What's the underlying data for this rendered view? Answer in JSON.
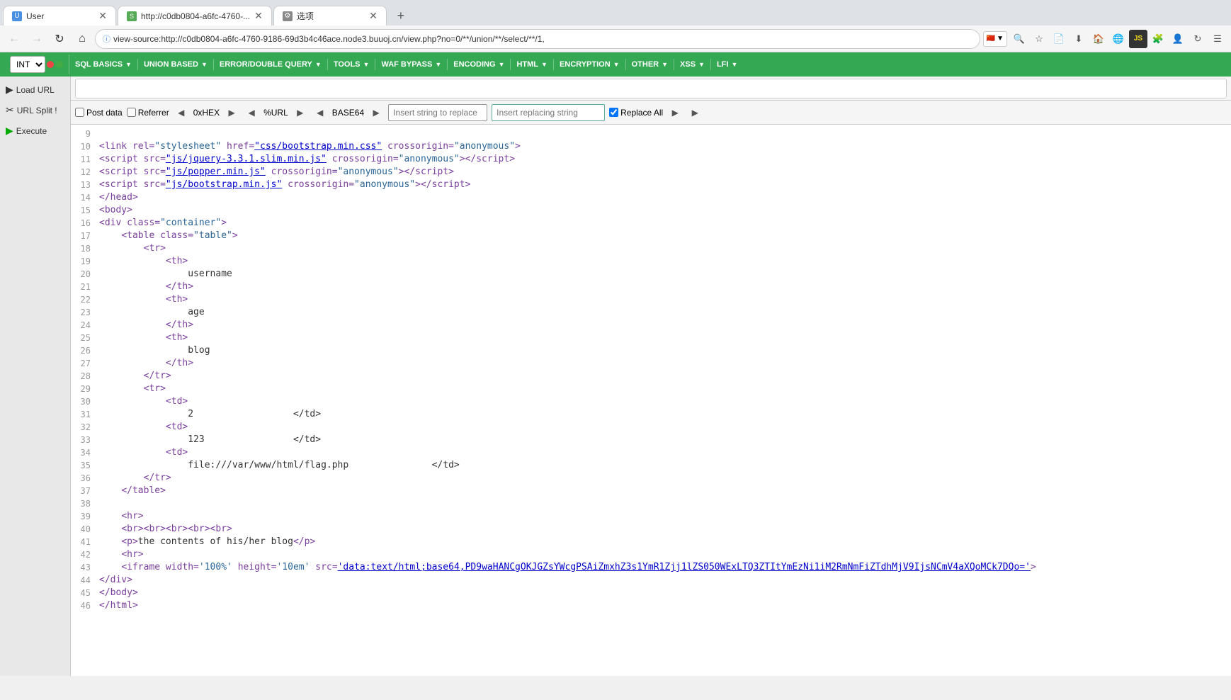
{
  "tabs": [
    {
      "id": "tab1",
      "title": "User",
      "favicon": "U",
      "active": false,
      "closeable": true
    },
    {
      "id": "tab2",
      "title": "http://c0db0804-a6fc-4760-...",
      "favicon": "S",
      "active": true,
      "closeable": true
    },
    {
      "id": "tab3",
      "title": "选项",
      "favicon": "⚙",
      "active": false,
      "closeable": true
    }
  ],
  "address": "view-source:http://c0db0804-a6fc-4760-9186-69d3b4c46ace.node3.buuoj.cn/view.php?no=0/**/union/**/select/**/1,",
  "ext_bar": {
    "items": [
      {
        "label": "INT",
        "dropdown": true
      },
      {
        "label": "SQL BASICS",
        "dropdown": true
      },
      {
        "label": "UNION BASED",
        "dropdown": true
      },
      {
        "label": "ERROR/DOUBLE QUERY",
        "dropdown": true
      },
      {
        "label": "TOOLS",
        "dropdown": true
      },
      {
        "label": "WAF BYPASS",
        "dropdown": true
      },
      {
        "label": "ENCODING",
        "dropdown": true
      },
      {
        "label": "HTML",
        "dropdown": true
      },
      {
        "label": "ENCRYPTION",
        "dropdown": true
      },
      {
        "label": "OTHER",
        "dropdown": true
      },
      {
        "label": "XSS",
        "dropdown": true
      },
      {
        "label": "LFI",
        "dropdown": true
      }
    ]
  },
  "sidebar": {
    "load_url": "Load URL",
    "split_url": "Split !",
    "split_label": "URL Split !",
    "execute": "Execute"
  },
  "toolbar": {
    "post_data_label": "Post data",
    "referrer_label": "Referrer",
    "hex_label": "0xHEX",
    "url_label": "%URL",
    "base64_label": "BASE64",
    "insert_from_placeholder": "Insert string to replace",
    "insert_to_placeholder": "Insert replacing string",
    "replace_all_label": "Replace All"
  },
  "source_lines": [
    {
      "num": "9",
      "parts": []
    },
    {
      "num": "10",
      "html": "<span class='line-content'><span class='tag'>&lt;link rel=</span><span class='attr-value'>\"stylesheet\"</span> <span class='tag'>href=</span><span class='link-text'>\"css/bootstrap.min.css\"</span> <span class='tag'>crossorigin=</span><span class='anon-text'>\"anonymous\"</span><span class='tag'>&gt;</span></span>"
    },
    {
      "num": "11",
      "html": "<span class='line-content'><span class='tag'>&lt;script src=</span><span class='link-text'>\"js/jquery-3.3.1.slim.min.js\"</span> <span class='tag'>crossorigin=</span><span class='anon-text'>\"anonymous\"</span><span class='tag'>&gt;&lt;/script&gt;</span></span>"
    },
    {
      "num": "12",
      "html": "<span class='line-content'><span class='tag'>&lt;script src=</span><span class='link-text'>\"js/popper.min.js\"</span> <span class='tag'>crossorigin=</span><span class='anon-text'>\"anonymous\"</span><span class='tag'>&gt;&lt;/script&gt;</span></span>"
    },
    {
      "num": "13",
      "html": "<span class='line-content'><span class='tag'>&lt;script src=</span><span class='link-text'>\"js/bootstrap.min.js\"</span> <span class='tag'>crossorigin=</span><span class='anon-text'>\"anonymous\"</span><span class='tag'>&gt;&lt;/script&gt;</span></span>"
    },
    {
      "num": "14",
      "html": "<span class='line-content'><span class='tag'>&lt;/head&gt;</span></span>"
    },
    {
      "num": "15",
      "html": "<span class='line-content'><span class='tag'>&lt;body&gt;</span></span>"
    },
    {
      "num": "16",
      "html": "<span class='line-content'><span class='tag'>&lt;div class=</span><span class='anon-text'>\"container\"</span><span class='tag'>&gt;</span></span>"
    },
    {
      "num": "17",
      "html": "<span class='line-content'>    <span class='tag'>&lt;table class=</span><span class='anon-text'>\"table\"</span><span class='tag'>&gt;</span></span>"
    },
    {
      "num": "18",
      "html": "<span class='line-content'>        <span class='tag'>&lt;tr&gt;</span></span>"
    },
    {
      "num": "19",
      "html": "<span class='line-content'>            <span class='tag'>&lt;th&gt;</span></span>"
    },
    {
      "num": "20",
      "html": "<span class='line-content'>                <span class='text-node'>username</span></span>"
    },
    {
      "num": "21",
      "html": "<span class='line-content'>            <span class='tag'>&lt;/th&gt;</span></span>"
    },
    {
      "num": "22",
      "html": "<span class='line-content'>            <span class='tag'>&lt;th&gt;</span></span>"
    },
    {
      "num": "23",
      "html": "<span class='line-content'>                <span class='text-node'>age</span></span>"
    },
    {
      "num": "24",
      "html": "<span class='line-content'>            <span class='tag'>&lt;/th&gt;</span></span>"
    },
    {
      "num": "25",
      "html": "<span class='line-content'>            <span class='tag'>&lt;th&gt;</span></span>"
    },
    {
      "num": "26",
      "html": "<span class='line-content'>                <span class='text-node'>blog</span></span>"
    },
    {
      "num": "27",
      "html": "<span class='line-content'>            <span class='tag'>&lt;/th&gt;</span></span>"
    },
    {
      "num": "28",
      "html": "<span class='line-content'>        <span class='tag'>&lt;/tr&gt;</span></span>"
    },
    {
      "num": "29",
      "html": "<span class='line-content'>        <span class='tag'>&lt;tr&gt;</span></span>"
    },
    {
      "num": "30",
      "html": "<span class='line-content'>            <span class='tag'>&lt;td&gt;</span></span>"
    },
    {
      "num": "31",
      "html": "<span class='line-content'>                <span class='text-node'>2                  &lt;/td&gt;</span></span>"
    },
    {
      "num": "32",
      "html": "<span class='line-content'>            <span class='tag'>&lt;td&gt;</span></span>"
    },
    {
      "num": "33",
      "html": "<span class='line-content'>                <span class='text-node'>123                &lt;/td&gt;</span></span>"
    },
    {
      "num": "34",
      "html": "<span class='line-content'>            <span class='tag'>&lt;td&gt;</span></span>"
    },
    {
      "num": "35",
      "html": "<span class='line-content'>                <span class='text-node'>file:///var/www/html/flag.php               &lt;/td&gt;</span></span>"
    },
    {
      "num": "36",
      "html": "<span class='line-content'>        <span class='tag'>&lt;/tr&gt;</span></span>"
    },
    {
      "num": "37",
      "html": "<span class='line-content'>    <span class='tag'>&lt;/table&gt;</span></span>"
    },
    {
      "num": "38",
      "html": "<span class='line-content'></span>"
    },
    {
      "num": "39",
      "html": "<span class='line-content'>    <span class='tag'>&lt;hr&gt;</span></span>"
    },
    {
      "num": "40",
      "html": "<span class='line-content'>    <span class='tag'>&lt;br&gt;&lt;br&gt;&lt;br&gt;&lt;br&gt;&lt;br&gt;</span></span>"
    },
    {
      "num": "41",
      "html": "<span class='line-content'>    <span class='tag'>&lt;p&gt;</span><span class='text-node'>the contents of his/her blog</span><span class='tag'>&lt;/p&gt;</span></span>"
    },
    {
      "num": "42",
      "html": "<span class='line-content'>    <span class='tag'>&lt;hr&gt;</span></span>"
    },
    {
      "num": "43",
      "html": "<span class='line-content'>    <span class='tag'>&lt;iframe width=</span><span class='anon-text'>'100%'</span> <span class='tag'>height=</span><span class='anon-text'>'10em'</span> <span class='tag'>src=</span><span class='link-text'>'data:text/html;base64,PD9waHANCgOKJGZsYWcgPSAiZmxhZ3s1YmR1Zjj1lZS050WExLTQ3ZTItYmEzNi1iM2RmNmFiZTdhMjV9IjsNCmV4aXQoMCk7DQo='</span><span class='tag'>&gt;</span></span>"
    },
    {
      "num": "44",
      "html": "<span class='line-content'><span class='tag'>&lt;/div&gt;</span></span>"
    },
    {
      "num": "45",
      "html": "<span class='line-content'><span class='tag'>&lt;/body&gt;</span></span>"
    },
    {
      "num": "46",
      "html": "<span class='line-content'><span class='tag'>&lt;/html&gt;</span></span>"
    }
  ]
}
